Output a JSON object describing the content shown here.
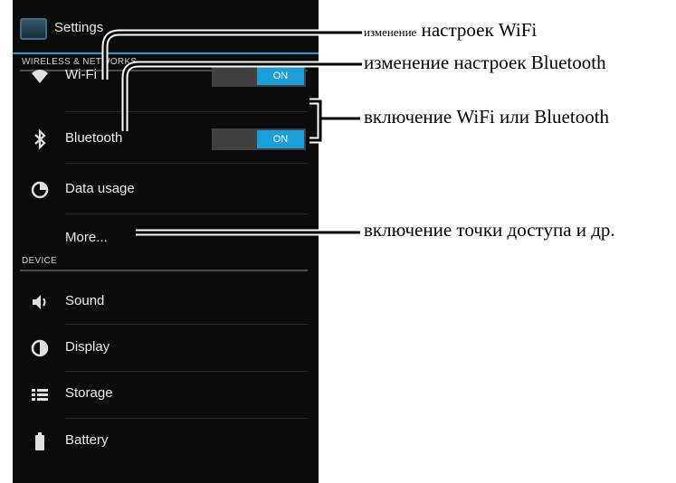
{
  "settings": {
    "title": "Settings",
    "sections": {
      "wireless": "WIRELESS & NETWORKS",
      "device": "DEVICE"
    },
    "items": {
      "wifi": {
        "label": "Wi-Fi",
        "icon": "wifi-icon",
        "toggle": "ON"
      },
      "bluetooth": {
        "label": "Bluetooth",
        "icon": "bluetooth-icon",
        "toggle": "ON"
      },
      "data_usage": {
        "label": "Data usage",
        "icon": "data-usage-icon"
      },
      "more": {
        "label": "More..."
      },
      "sound": {
        "label": "Sound",
        "icon": "speaker-icon"
      },
      "display": {
        "label": "Display",
        "icon": "brightness-icon"
      },
      "storage": {
        "label": "Storage",
        "icon": "storage-icon"
      },
      "battery": {
        "label": "Battery",
        "icon": "battery-icon"
      }
    }
  },
  "annotations": {
    "wifi_settings_small": "изменение",
    "wifi_settings_rest": " настроек WiFi",
    "bluetooth_settings": "изменение настроек Bluetooth",
    "toggle_enable": "включение WiFi или Bluetooth",
    "more_hotspot": "включение точки доступа и др."
  },
  "colors": {
    "accent": "#1b9fd8",
    "background": "#0b0b0b"
  }
}
